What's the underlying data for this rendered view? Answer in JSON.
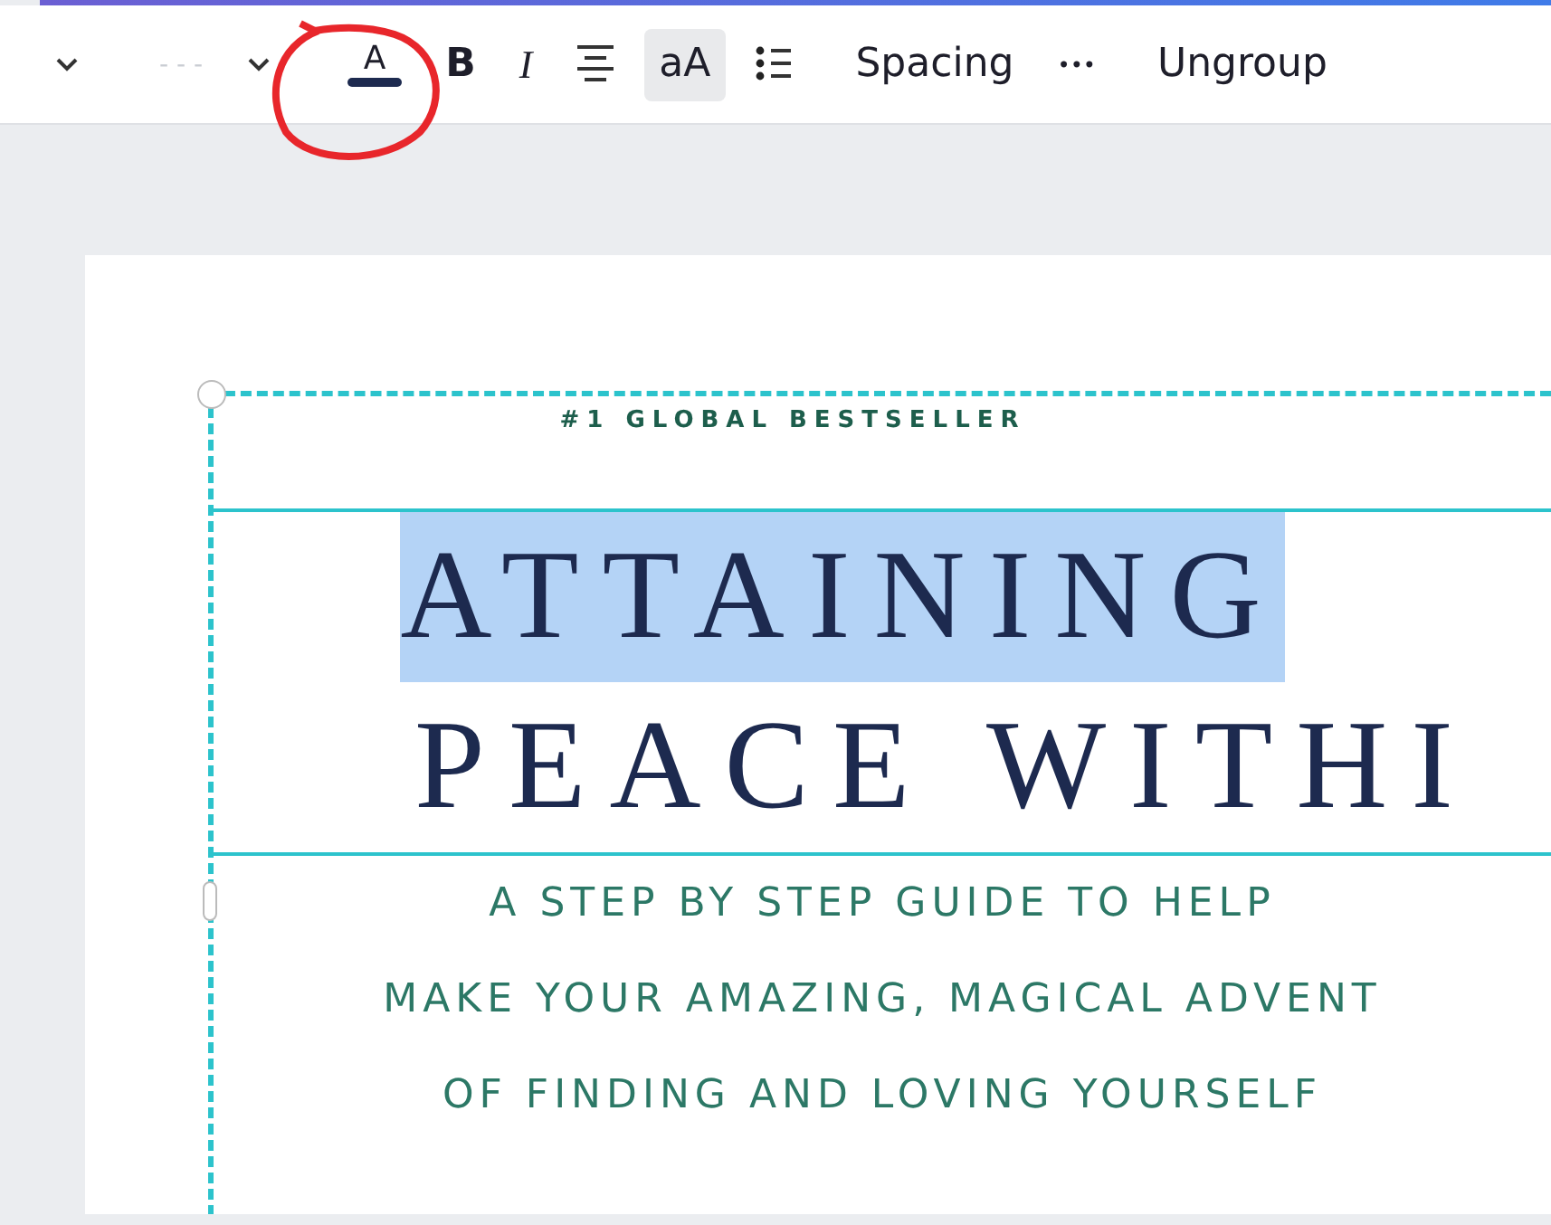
{
  "toolbar": [
    {
      "kind": "chevron",
      "selected": false
    },
    {
      "kind": "placeholder",
      "label": "- - -",
      "selected": false
    },
    {
      "kind": "chevron",
      "selected": false
    },
    {
      "kind": "text-color",
      "label": "A",
      "selected": false
    },
    {
      "kind": "text",
      "label": "B",
      "selected": false
    },
    {
      "kind": "text",
      "label": "I",
      "selected": false
    },
    {
      "kind": "align",
      "selected": false
    },
    {
      "kind": "text",
      "label": "aA",
      "selected": true
    },
    {
      "kind": "list",
      "selected": false
    },
    {
      "kind": "text",
      "label": "Spacing",
      "selected": false
    },
    {
      "kind": "text",
      "label": "•••",
      "selected": false
    },
    {
      "kind": "text",
      "label": "Ungroup",
      "selected": false
    }
  ],
  "page": {
    "kicker": "#1 GLOBAL BESTSELLER",
    "title_lines": [
      {
        "text": "ATTAINING",
        "selected": true
      },
      {
        "text": "PEACE WITHI",
        "selected": false
      }
    ],
    "subtitle_lines": [
      "A STEP BY STEP GUIDE TO HELP",
      "MAKE YOUR AMAZING, MAGICAL ADVENT",
      "OF FINDING AND LOVING YOURSELF"
    ]
  }
}
